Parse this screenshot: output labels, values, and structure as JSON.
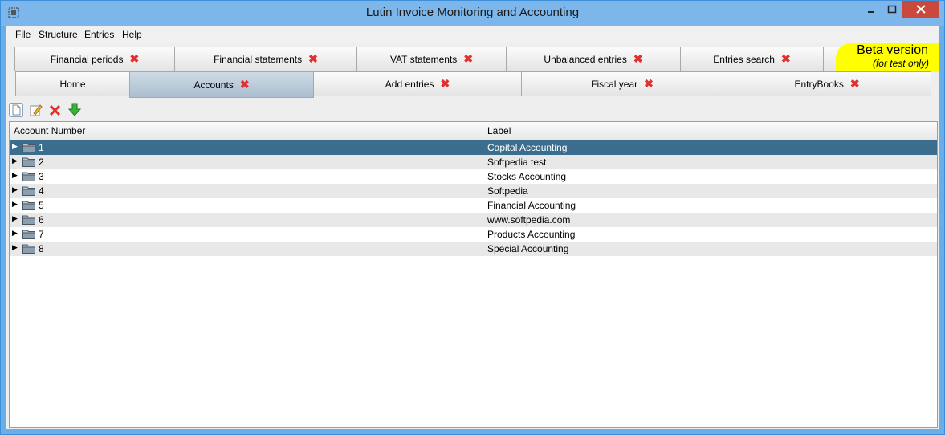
{
  "window": {
    "title": "Lutin Invoice Monitoring and Accounting"
  },
  "menu": [
    {
      "label_first": "F",
      "label_rest": "ile"
    },
    {
      "label_first": "S",
      "label_rest": "tructure"
    },
    {
      "label_first": "E",
      "label_rest": "ntries"
    },
    {
      "label_first": "H",
      "label_rest": "elp"
    }
  ],
  "tabs_row1": [
    {
      "label": "Financial periods"
    },
    {
      "label": "Financial statements"
    },
    {
      "label": "VAT statements"
    },
    {
      "label": "Unbalanced entries"
    },
    {
      "label": "Entries search"
    }
  ],
  "tabs_row2": [
    {
      "label": "Home"
    },
    {
      "label": "Accounts"
    },
    {
      "label": "Add entries"
    },
    {
      "label": "Fiscal year"
    },
    {
      "label": "EntryBooks"
    }
  ],
  "beta": {
    "title": "Beta version",
    "subtitle": "(for test only)"
  },
  "table": {
    "columns": [
      "Account Number",
      "Label"
    ],
    "rows": [
      {
        "number": "1",
        "label": "Capital Accounting",
        "selected": true
      },
      {
        "number": "2",
        "label": "Softpedia test"
      },
      {
        "number": "3",
        "label": "Stocks Accounting"
      },
      {
        "number": "4",
        "label": "Softpedia"
      },
      {
        "number": "5",
        "label": "Financial Accounting"
      },
      {
        "number": "6",
        "label": "www.softpedia.com"
      },
      {
        "number": "7",
        "label": "Products Accounting"
      },
      {
        "number": "8",
        "label": "Special Accounting"
      }
    ]
  },
  "colors": {
    "selection": "#3b6e8e",
    "close_tab": "#e03030",
    "beta_bg": "#ffff00"
  }
}
